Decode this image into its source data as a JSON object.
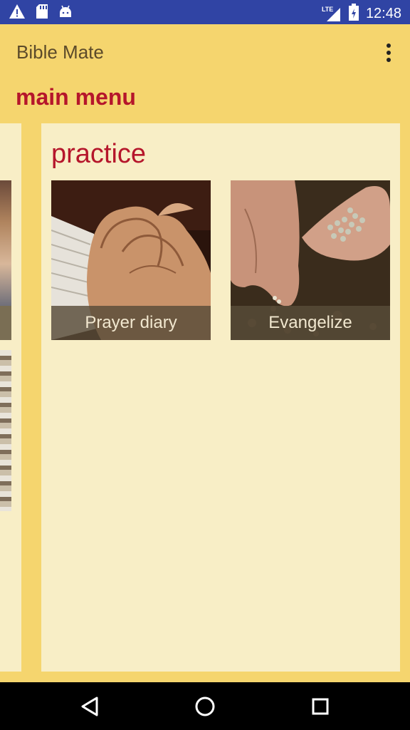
{
  "status_bar": {
    "time": "12:48",
    "network": "LTE",
    "icons": [
      "warning-icon",
      "sd-card-icon",
      "android-icon",
      "signal-icon",
      "battery-icon"
    ]
  },
  "app_bar": {
    "title": "Bible Mate",
    "overflow_icon": "more-vert-icon"
  },
  "section": {
    "title": "main menu"
  },
  "card": {
    "title": "practice",
    "tiles": [
      {
        "label": "Prayer diary",
        "image": "praying-hands-image"
      },
      {
        "label": "Evangelize",
        "image": "hands-seeds-image"
      }
    ]
  },
  "nav_bar": {
    "icons": [
      "back-icon",
      "home-icon",
      "recents-icon"
    ]
  },
  "colors": {
    "status_bar": "#3044A4",
    "app_background": "#F5D56E",
    "card_background": "#F8EEC6",
    "accent_red": "#B5162B"
  }
}
